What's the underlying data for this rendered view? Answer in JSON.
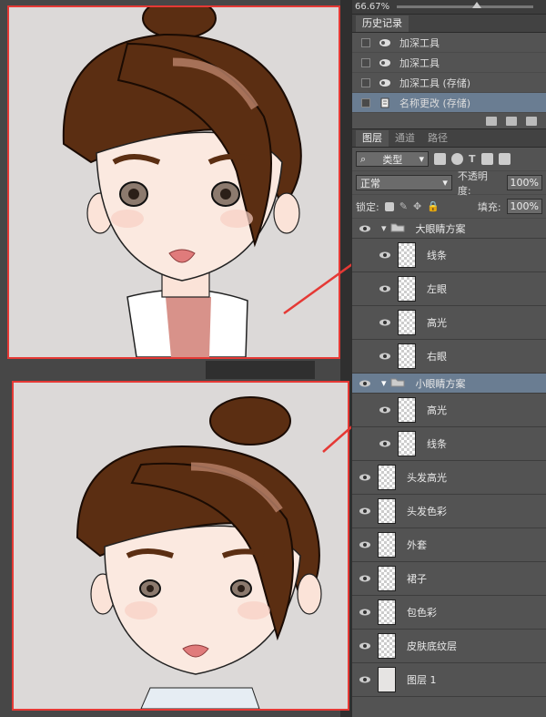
{
  "topbar": {
    "zoom": "66.67%"
  },
  "history": {
    "tab": "历史记录",
    "items": [
      {
        "label": "加深工具",
        "selected": false
      },
      {
        "label": "加深工具",
        "selected": false
      },
      {
        "label": "加深工具 (存储)",
        "selected": false
      },
      {
        "label": "名称更改 (存储)",
        "selected": true
      }
    ]
  },
  "layers_panel": {
    "tabs": [
      "图层",
      "通道",
      "路径"
    ],
    "filter_label": "类型",
    "blend_mode": "正常",
    "opacity_label": "不透明度:",
    "opacity_value": "100%",
    "lock_label": "锁定:",
    "fill_label": "填充:",
    "fill_value": "100%",
    "group1": "大眼睛方案",
    "group1_layers": [
      "线条",
      "左眼",
      "高光",
      "右眼"
    ],
    "group2": "小眼睛方案",
    "group2_layers": [
      "高光",
      "线条"
    ],
    "layers": [
      "头发高光",
      "头发色彩",
      "外套",
      "裙子",
      "包色彩",
      "皮肤底纹层",
      "图层 1"
    ]
  },
  "colors": {
    "annotation_red": "#e53935",
    "hair": "#5b2e12",
    "skin": "#fbe9e0",
    "selected_row": "#6a7d92"
  }
}
